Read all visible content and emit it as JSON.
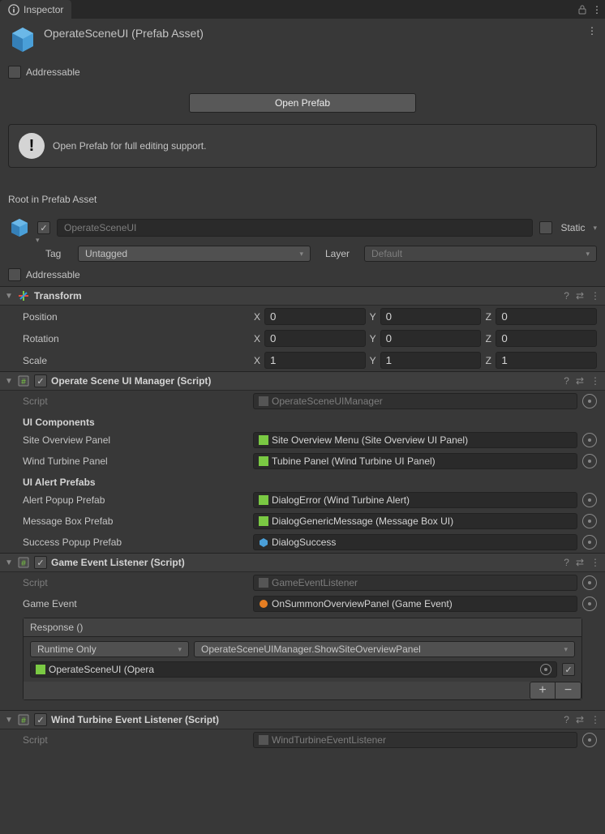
{
  "tab": {
    "title": "Inspector"
  },
  "asset": {
    "title": "OperateSceneUI (Prefab Asset)",
    "addressable_label": "Addressable"
  },
  "open_prefab_btn": "Open Prefab",
  "notice": "Open Prefab for full editing support.",
  "root_label": "Root in Prefab Asset",
  "gameobject": {
    "name": "OperateSceneUI",
    "static_label": "Static",
    "tag_label": "Tag",
    "tag_value": "Untagged",
    "layer_label": "Layer",
    "layer_value": "Default",
    "addressable_label": "Addressable"
  },
  "transform": {
    "title": "Transform",
    "position_label": "Position",
    "rotation_label": "Rotation",
    "scale_label": "Scale",
    "px": "0",
    "py": "0",
    "pz": "0",
    "rx": "0",
    "ry": "0",
    "rz": "0",
    "sx": "1",
    "sy": "1",
    "sz": "1"
  },
  "ui_manager": {
    "title": "Operate Scene UI Manager (Script)",
    "script_label": "Script",
    "script_value": "OperateSceneUIManager",
    "ui_components_header": "UI Components",
    "site_overview_label": "Site Overview Panel",
    "site_overview_value": "Site Overview Menu (Site Overview UI Panel)",
    "wind_turbine_label": "Wind Turbine Panel",
    "wind_turbine_value": "Tubine Panel (Wind Turbine UI Panel)",
    "alert_prefabs_header": "UI Alert Prefabs",
    "alert_popup_label": "Alert Popup Prefab",
    "alert_popup_value": "DialogError (Wind Turbine Alert)",
    "message_box_label": "Message Box Prefab",
    "message_box_value": "DialogGenericMessage (Message Box UI)",
    "success_popup_label": "Success Popup Prefab",
    "success_popup_value": "DialogSuccess"
  },
  "game_event_listener": {
    "title": "Game Event Listener (Script)",
    "script_label": "Script",
    "script_value": "GameEventListener",
    "game_event_label": "Game Event",
    "game_event_value": "OnSummonOverviewPanel (Game Event)",
    "response_title": "Response ()",
    "runtime_value": "Runtime Only",
    "function_value": "OperateSceneUIManager.ShowSiteOverviewPanel",
    "target_value": "OperateSceneUI (Opera"
  },
  "wind_listener": {
    "title": "Wind Turbine Event Listener (Script)",
    "script_label": "Script",
    "script_value": "WindTurbineEventListener"
  },
  "axis": {
    "x": "X",
    "y": "Y",
    "z": "Z"
  }
}
